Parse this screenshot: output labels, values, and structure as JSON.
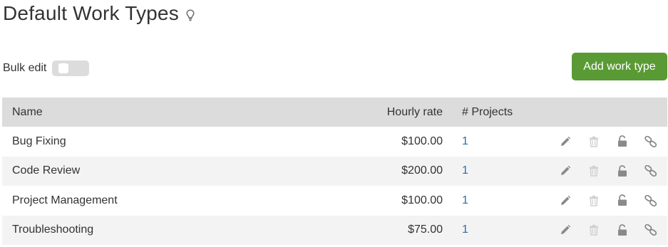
{
  "page": {
    "title": "Default Work Types",
    "hint_icon": "lightbulb-icon"
  },
  "toolbar": {
    "bulk_edit_label": "Bulk edit",
    "bulk_edit_enabled": false,
    "add_button_label": "Add work type"
  },
  "colors": {
    "accent_green": "#5a9a35",
    "header_bg": "#dcdcdc",
    "row_alt_bg": "#f3f3f3",
    "link_blue": "#2a6fa8",
    "icon_gray": "#8a8a8a",
    "icon_disabled": "#cfcfcf"
  },
  "table": {
    "columns": [
      "Name",
      "Hourly rate",
      "# Projects"
    ],
    "row_actions": [
      "pencil-icon",
      "trash-icon",
      "unlock-icon",
      "link-icon"
    ],
    "rows": [
      {
        "name": "Bug Fixing",
        "rate": "$100.00",
        "projects": "1"
      },
      {
        "name": "Code Review",
        "rate": "$200.00",
        "projects": "1"
      },
      {
        "name": "Project Management",
        "rate": "$100.00",
        "projects": "1"
      },
      {
        "name": "Troubleshooting",
        "rate": "$75.00",
        "projects": "1"
      }
    ]
  }
}
